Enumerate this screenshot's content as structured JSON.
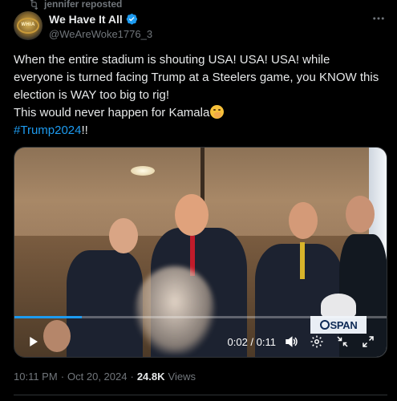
{
  "repost": {
    "text": "jennifer reposted",
    "icon": "repost-icon"
  },
  "author": {
    "display_name": "We Have It All",
    "handle": "@WeAreWoke1776_3",
    "verified": true,
    "avatar_label": "WHIA"
  },
  "tweet": {
    "line1": "When the entire stadium is shouting USA! USA! USA! while everyone is turned facing Trump at a Steelers game, you KNOW this election is WAY too big to rig!",
    "line2": "This would never happen for Kamala",
    "hashtag": "#Trump2024",
    "hashtag_suffix": "!!"
  },
  "video": {
    "current_time": "0:02",
    "duration": "0:11",
    "time_separator": " / ",
    "progress": 0.18,
    "watermark": "SPAN",
    "accent_color": "#1d9bf0"
  },
  "meta": {
    "time": "10:11 PM",
    "separator": "·",
    "date": "Oct 20, 2024",
    "views_count": "24.8K",
    "views_label": "Views"
  },
  "colors": {
    "background": "#000000",
    "text": "#e7e9ea",
    "muted": "#71767b",
    "link": "#1d9bf0"
  }
}
